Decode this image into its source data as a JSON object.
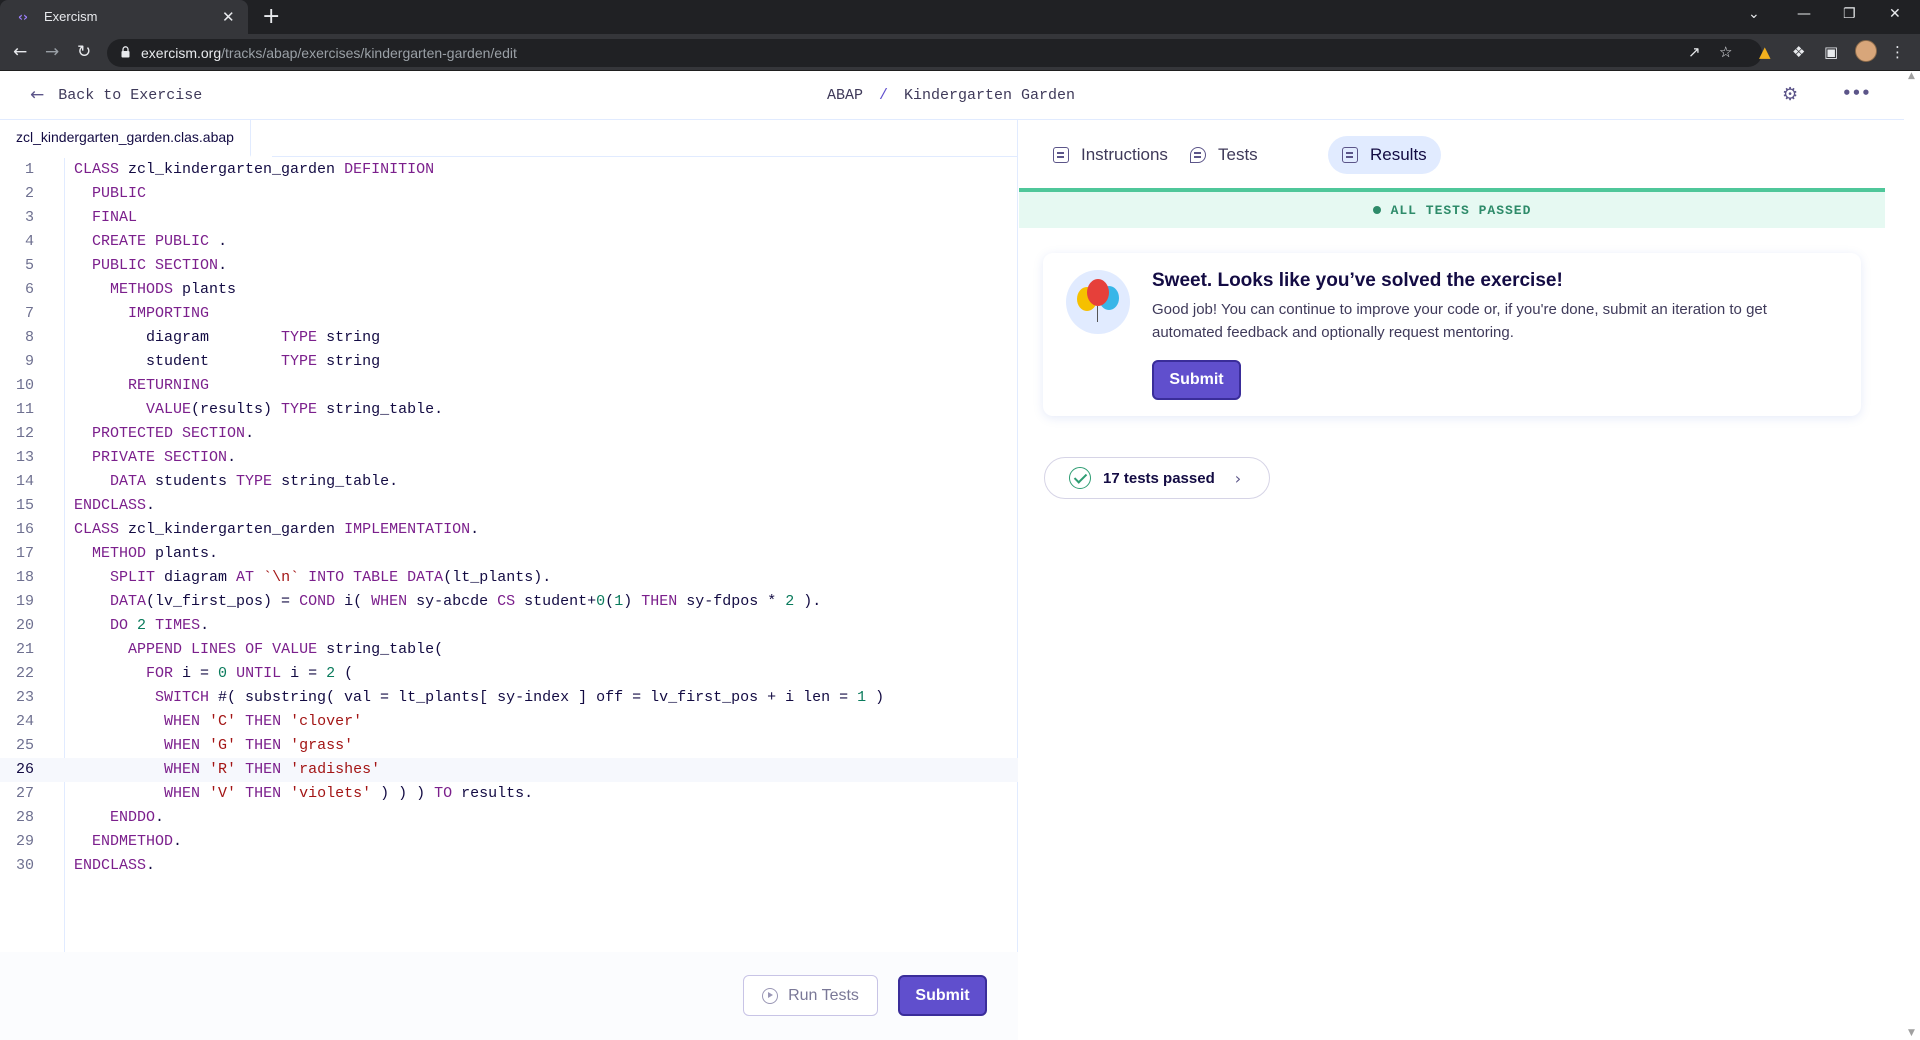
{
  "browser": {
    "tab_title": "Exercism",
    "tab_close": "✕",
    "new_tab": "+",
    "url_host": "exercism.org",
    "url_path": "/tracks/abap/exercises/kindergarten-garden/edit",
    "window_controls": [
      "⌄",
      "—",
      "❐",
      "✕"
    ]
  },
  "header": {
    "back_label": "Back to Exercise",
    "track": "ABAP",
    "separator": "/",
    "exercise": "Kindergarten Garden"
  },
  "editor": {
    "file_name": "zcl_kindergarten_garden.clas.abap",
    "active_line": 26,
    "lines": [
      "CLASS zcl_kindergarten_garden DEFINITION",
      "  PUBLIC",
      "  FINAL",
      "  CREATE PUBLIC .",
      "  PUBLIC SECTION.",
      "    METHODS plants",
      "      IMPORTING",
      "        diagram        TYPE string",
      "        student        TYPE string",
      "      RETURNING",
      "        VALUE(results) TYPE string_table.",
      "  PROTECTED SECTION.",
      "  PRIVATE SECTION.",
      "    DATA students TYPE string_table.",
      "ENDCLASS.",
      "CLASS zcl_kindergarten_garden IMPLEMENTATION.",
      "  METHOD plants.",
      "    SPLIT diagram AT `\\n` INTO TABLE DATA(lt_plants).",
      "    DATA(lv_first_pos) = COND i( WHEN sy-abcde CS student+0(1) THEN sy-fdpos * 2 ).",
      "    DO 2 TIMES.",
      "      APPEND LINES OF VALUE string_table(",
      "        FOR i = 0 UNTIL i = 2 (",
      "         SWITCH #( substring( val = lt_plants[ sy-index ] off = lv_first_pos + i len = 1 )",
      "          WHEN 'C' THEN 'clover'",
      "          WHEN 'G' THEN 'grass'",
      "          WHEN 'R' THEN 'radishes'",
      "          WHEN 'V' THEN 'violets' ) ) ) TO results.",
      "    ENDDO.",
      "  ENDMETHOD.",
      "ENDCLASS."
    ],
    "run_tests_label": "Run Tests",
    "submit_label": "Submit"
  },
  "panel": {
    "tabs": [
      {
        "label": "Instructions",
        "icon": "instructions-icon",
        "selected": false
      },
      {
        "label": "Tests",
        "icon": "tests-icon",
        "selected": false
      },
      {
        "label": "Results",
        "icon": "results-icon",
        "selected": true
      }
    ],
    "status": "ALL TESTS PASSED",
    "success_title": "Sweet. Looks like you’ve solved the exercise!",
    "success_text": "Good job! You can continue to improve your code or, if you're done, submit an iteration to get automated feedback and optionally request mentoring.",
    "submit_label": "Submit",
    "tests_passed": "17 tests passed"
  },
  "colors": {
    "accent": "#604fcd",
    "success": "#4fc79a",
    "keyword": "#7b1f8c",
    "string": "#a31515"
  }
}
